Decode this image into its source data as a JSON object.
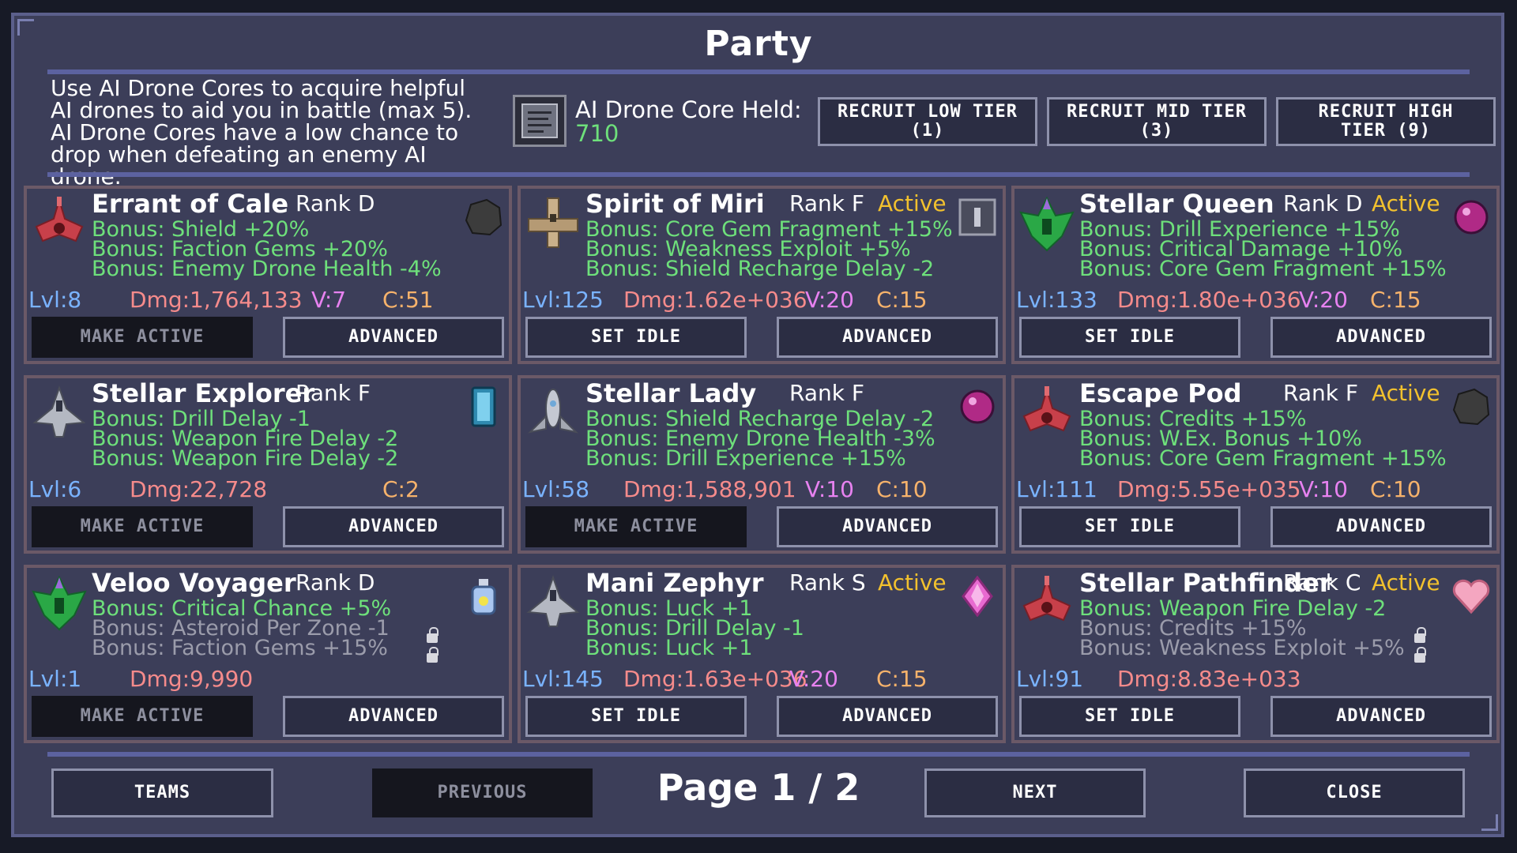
{
  "title": "Party",
  "description": "Use AI Drone Cores to acquire helpful AI drones to aid you in battle (max 5). AI Drone Cores have a low chance to drop when defeating an enemy AI drone.",
  "core": {
    "icon": "drone-core-chip-icon",
    "label": "AI Drone Core Held:",
    "value": "710"
  },
  "recruit": [
    {
      "label": "RECRUIT LOW TIER (1)"
    },
    {
      "label": "RECRUIT MID TIER (3)"
    },
    {
      "label": "RECRUIT HIGH TIER (9)"
    }
  ],
  "cards": [
    {
      "name": "Errant of Cale",
      "rank": "Rank D",
      "active": "",
      "drone_icon": "red-drone-icon",
      "gem_icon": "asteroid-rock-icon",
      "bonuses": [
        "Bonus: Shield +20%",
        "Bonus: Faction Gems +20%",
        "Bonus: Enemy Drone Health -4%"
      ],
      "lvl": "Lvl:8",
      "dmg": "Dmg:1,764,133",
      "v": "V:7",
      "c": "C:51",
      "primary": "MAKE ACTIVE",
      "secondary": "ADVANCED"
    },
    {
      "name": "Spirit of Miri",
      "rank": "Rank F",
      "active": "Active",
      "drone_icon": "tan-gunship-icon",
      "gem_icon": "rune-tablet-icon",
      "bonuses": [
        "Bonus: Core Gem Fragment +15%",
        "Bonus: Weakness Exploit +5%",
        "Bonus: Shield Recharge Delay -2"
      ],
      "lvl": "Lvl:125",
      "dmg": "Dmg:1.62e+036",
      "v": "V:20",
      "c": "C:15",
      "primary": "SET IDLE",
      "secondary": "ADVANCED"
    },
    {
      "name": "Stellar Queen",
      "rank": "Rank D",
      "active": "Active",
      "drone_icon": "green-drone-icon",
      "gem_icon": "purple-orb-icon",
      "bonuses": [
        "Bonus: Drill Experience +15%",
        "Bonus: Critical Damage +10%",
        "Bonus: Core Gem Fragment +15%"
      ],
      "lvl": "Lvl:133",
      "dmg": "Dmg:1.80e+036",
      "v": "V:20",
      "c": "C:15",
      "primary": "SET IDLE",
      "secondary": "ADVANCED"
    },
    {
      "name": "Stellar Explorer",
      "rank": "Rank F",
      "active": "",
      "drone_icon": "grey-fighter-icon",
      "gem_icon": "blue-canister-icon",
      "bonuses": [
        "Bonus: Drill Delay -1",
        "Bonus: Weapon Fire Delay -2",
        "Bonus: Weapon Fire Delay -2"
      ],
      "lvl": "Lvl:6",
      "dmg": "Dmg:22,728",
      "v": "",
      "c": "C:2",
      "primary": "MAKE ACTIVE",
      "secondary": "ADVANCED"
    },
    {
      "name": "Stellar Lady",
      "rank": "Rank F",
      "active": "",
      "drone_icon": "grey-rocket-icon",
      "gem_icon": "purple-orb-icon",
      "bonuses": [
        "Bonus: Shield Recharge Delay -2",
        "Bonus: Enemy Drone Health -3%",
        "Bonus: Drill Experience +15%"
      ],
      "lvl": "Lvl:58",
      "dmg": "Dmg:1,588,901",
      "v": "V:10",
      "c": "C:10",
      "primary": "MAKE ACTIVE",
      "secondary": "ADVANCED"
    },
    {
      "name": "Escape Pod",
      "rank": "Rank F",
      "active": "Active",
      "drone_icon": "red-drone-icon",
      "gem_icon": "asteroid-rock-icon",
      "bonuses": [
        "Bonus: Credits +15%",
        "Bonus: W.Ex. Bonus +10%",
        "Bonus: Core Gem Fragment +15%"
      ],
      "lvl": "Lvl:111",
      "dmg": "Dmg:5.55e+035",
      "v": "V:10",
      "c": "C:10",
      "primary": "SET IDLE",
      "secondary": "ADVANCED"
    },
    {
      "name": "Veloo Voyager",
      "rank": "Rank D",
      "active": "",
      "drone_icon": "green-drone-icon",
      "gem_icon": "potion-bottle-icon",
      "bonuses": [
        "Bonus: Critical Chance +5%",
        "Bonus: Asteroid Per Zone -1",
        "Bonus: Faction Gems +15%"
      ],
      "lvl": "Lvl:1",
      "dmg": "Dmg:9,990",
      "v": "",
      "c": "",
      "primary": "MAKE ACTIVE",
      "secondary": "ADVANCED"
    },
    {
      "name": "Mani Zephyr",
      "rank": "Rank S",
      "active": "Active",
      "drone_icon": "grey-fighter-icon",
      "gem_icon": "pink-crystal-icon",
      "bonuses": [
        "Bonus: Luck +1",
        "Bonus: Drill Delay -1",
        "Bonus: Luck +1"
      ],
      "lvl": "Lvl:145",
      "dmg": "Dmg:1.63e+036",
      "v": "V:20",
      "c": "C:15",
      "primary": "SET IDLE",
      "secondary": "ADVANCED"
    },
    {
      "name": "Stellar Pathfinder",
      "rank": "Rank C",
      "active": "Active",
      "drone_icon": "red-drone-icon",
      "gem_icon": "pink-heart-icon",
      "bonuses": [
        "Bonus: Weapon Fire Delay -2",
        "Bonus: Credits +15%",
        "Bonus: Weakness Exploit +5%"
      ],
      "lvl": "Lvl:91",
      "dmg": "Dmg:8.83e+033",
      "v": "",
      "c": "",
      "primary": "SET IDLE",
      "secondary": "ADVANCED"
    }
  ],
  "footer": {
    "teams": "TEAMS",
    "previous": "PREVIOUS",
    "page": "Page 1 / 2",
    "next": "NEXT",
    "close": "CLOSE"
  }
}
